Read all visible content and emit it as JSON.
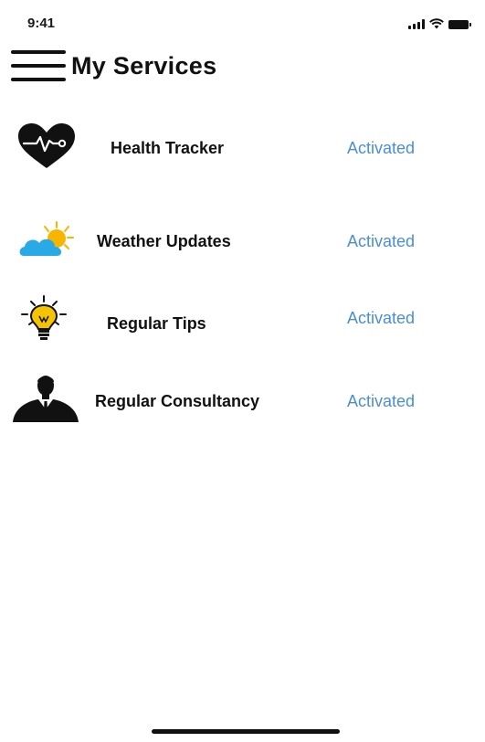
{
  "status_bar": {
    "time": "9:41",
    "icons": [
      "signal-icon",
      "wifi-icon",
      "battery-icon"
    ]
  },
  "header": {
    "title": "My Services",
    "menu_icon": "hamburger-menu-icon"
  },
  "services": [
    {
      "name": "Health Tracker",
      "status": "Activated",
      "icon": "heart-pulse-icon"
    },
    {
      "name": "Weather Updates",
      "status": "Activated",
      "icon": "sun-cloud-icon"
    },
    {
      "name": "Regular Tips",
      "status": "Activated",
      "icon": "lightbulb-icon"
    },
    {
      "name": "Regular Consultancy",
      "status": "Activated",
      "icon": "consultant-person-icon"
    }
  ],
  "colors": {
    "status_text": "#4a8fcf",
    "bulb": "#f5c400",
    "cloud": "#29a9e6",
    "sun": "#f7b500"
  }
}
